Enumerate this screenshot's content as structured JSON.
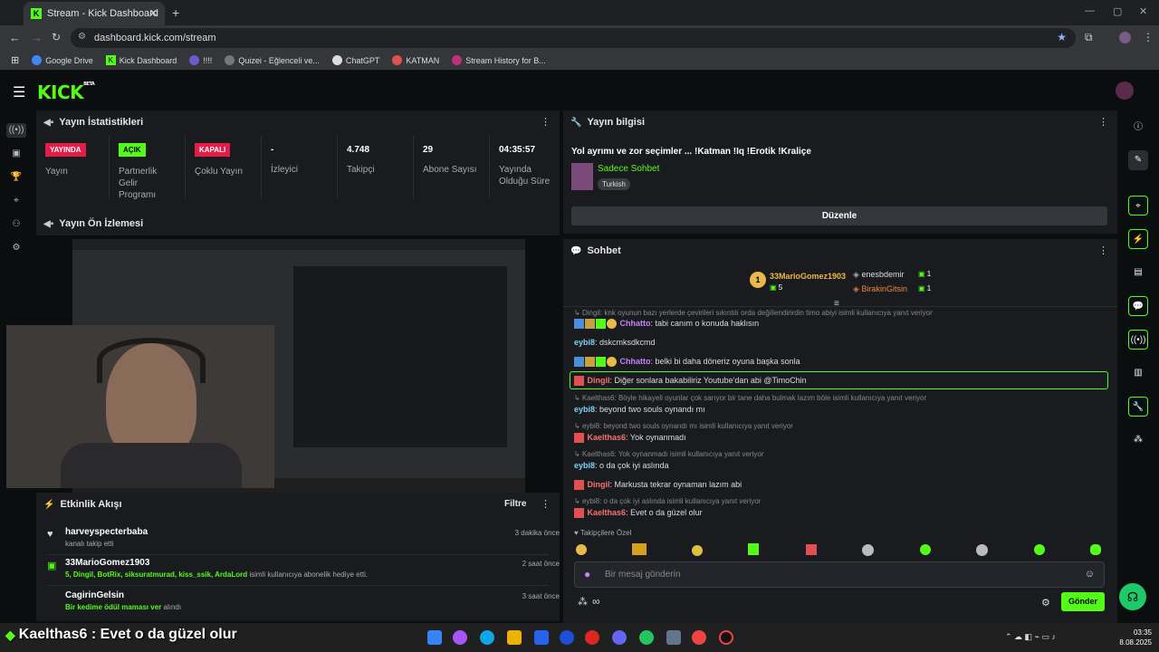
{
  "browser": {
    "tab_title": "Stream - Kick Dashboard",
    "url": "dashboard.kick.com/stream",
    "bookmarks": [
      "Google Drive",
      "Kick Dashboard",
      "!!!!",
      "Quizei - Eğlenceli ve...",
      "ChatGPT",
      "KATMAN",
      "Stream History for B..."
    ]
  },
  "app": {
    "logo": "KICK",
    "logo_sup": "BETA"
  },
  "stats": {
    "title": "Yayın İstatistikleri",
    "items": [
      {
        "badge": "YAYINDA",
        "label": "Yayın"
      },
      {
        "badge": "AÇIK",
        "label": "Partnerlik Gelir Programı"
      },
      {
        "badge": "KAPALI",
        "label": "Çoklu Yayın"
      },
      {
        "value": "-",
        "label": "İzleyici"
      },
      {
        "value": "4.748",
        "label": "Takipçi"
      },
      {
        "value": "29",
        "label": "Abone Sayısı"
      },
      {
        "value": "04:35:57",
        "label": "Yayında Olduğu Süre"
      }
    ]
  },
  "preview": {
    "title": "Yayın Ön İzlemesi"
  },
  "activity": {
    "title": "Etkinlik Akışı",
    "filter": "Filtre",
    "items": [
      {
        "name": "harveyspecterbaba",
        "sub": "kanalı takip etti",
        "time": "3 dakika önce"
      },
      {
        "name": "33MarioGomez1903",
        "sub_names": "5, Dingil, BotRix, siksuratmurad, kiss_ssik, ArdaLord",
        "sub": "isimli kullanıcıya abonelik hediye etti.",
        "time": "2 saat önce"
      },
      {
        "name": "CagirinGelsin",
        "sub_names": "Bir kedime ödül maması ver",
        "sub": "alındı",
        "time": "3 saat önce"
      }
    ]
  },
  "info": {
    "title": "Yayın bilgisi",
    "stream_title": "Yol ayrımı ve zor seçimler ... !Katman !Iq !Erotik !Kraliçe",
    "category": "Sadece Sohbet",
    "language": "Turkish",
    "edit_button": "Düzenle"
  },
  "chat": {
    "title": "Sohbet",
    "top": [
      {
        "name": "33MarioGomez1903",
        "count": "5"
      },
      {
        "name": "enesbdemir",
        "count": "1"
      },
      {
        "name": "BirakinGitsin",
        "count": "1"
      }
    ],
    "messages": [
      {
        "type": "reply",
        "text": "Dingil: knk oyunun bazı yerlerde çevirileri sıkıntılı orda değiliendirirdin timo abiyi isimli kullanıcıya yanıt veriyor"
      },
      {
        "user": "Chhatto",
        "text": "tabi canım o konuda haklısın",
        "color": "#c084fc"
      },
      {
        "user": "eybi8",
        "text": "dskcmksdkcmd",
        "color": "#7dd3fc"
      },
      {
        "user": "Chhatto",
        "text": "belki bi daha döneriz oyuna başka sonla",
        "color": "#c084fc"
      },
      {
        "user": "Dingil",
        "text": "Diğer sonlara bakabiliriz Youtube'dan abi @TimoChin",
        "color": "#f87171"
      },
      {
        "type": "reply",
        "text": "Kaelthas6: Böyle hikayeli oyunlar çok sarıyor bir tane daha bulmak lazım böle isimli kullanıcıya yanıt veriyor"
      },
      {
        "user": "eybi8",
        "text": "beyond two souls oynandı mı",
        "color": "#7dd3fc"
      },
      {
        "type": "reply",
        "text": "eybi8: beyond two souls oynandı mı isimli kullanıcıya yanıt veriyor"
      },
      {
        "user": "Kaelthas6",
        "text": "Yok oynanmadı",
        "color": "#f87171"
      },
      {
        "type": "reply",
        "text": "Kaelthas6: Yok oynanmadı isimli kullanıcıya yanıt veriyor"
      },
      {
        "user": "eybi8",
        "text": "o da çok iyi aslında",
        "color": "#7dd3fc"
      },
      {
        "user": "Dingil",
        "text": "Markusta tekrar oynaman lazım abi",
        "color": "#f87171"
      },
      {
        "type": "reply",
        "text": "eybi8: o da çok iyi aslında isimli kullanıcıya yanıt veriyor"
      },
      {
        "user": "Kaelthas6",
        "text": "Evet o da güzel olur",
        "color": "#f87171"
      }
    ],
    "followers_only": "Takipçilere Özel",
    "input_placeholder": "Bir mesaj gönderin",
    "send_button": "Gönder",
    "infinity": "∞"
  },
  "overlay": {
    "text": "Kaelthas6 : Evet o da güzel olur"
  },
  "taskbar": {
    "time": "03:35",
    "date": "8.08.2025"
  },
  "colors": {
    "kick_green": "#53fc18",
    "panel": "#191b1f",
    "live_red": "#e11d48"
  }
}
